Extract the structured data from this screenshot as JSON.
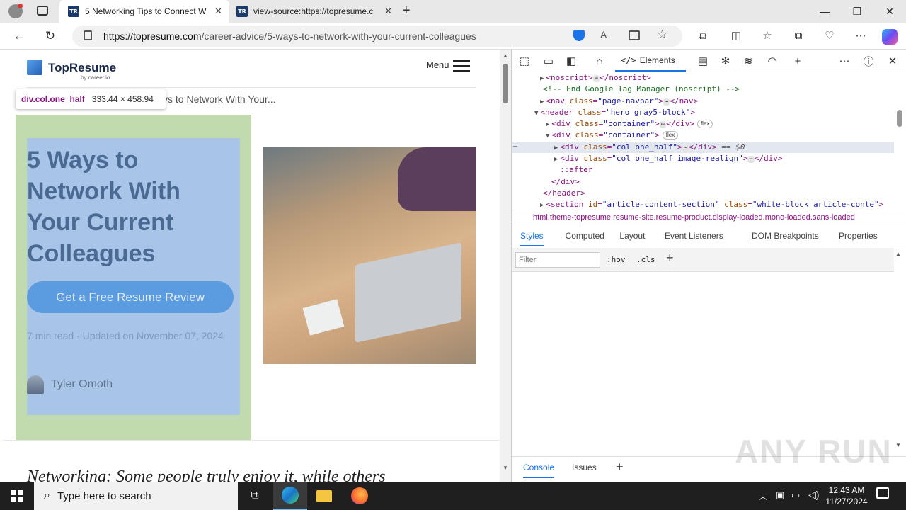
{
  "browser": {
    "tabs": [
      {
        "title": "5 Networking Tips to Connect W",
        "favicon": "TR"
      },
      {
        "title": "view-source:https://topresume.c",
        "favicon": "TR"
      }
    ],
    "url_host": "https://topresume.com",
    "url_path": "/career-advice/5-ways-to-network-with-your-current-colleagues"
  },
  "site": {
    "brand": "TopResume",
    "brand_sub": "by career.io",
    "menu_label": "Menu",
    "breadcrumb": "ys to Network With Your...",
    "inspect_tooltip": {
      "selector": "div.col.one_half",
      "dims": "333.44 × 458.94"
    },
    "heading": "5 Ways to Network With Your Current Colleagues",
    "cta": "Get a Free Resume Review",
    "meta": "7 min read · Updated on November 07, 2024",
    "author": "Tyler Omoth",
    "body_start": "Networking: Some people truly enjoy it, while others"
  },
  "devtools": {
    "elements_tab": "Elements",
    "lines": [
      {
        "indent": 40,
        "arrow": "▶",
        "html": "<noscript>",
        "dots": true,
        "close": "</noscript>"
      },
      {
        "indent": 44,
        "comment": "<!-- End Google Tag Manager (noscript) -->"
      },
      {
        "indent": 40,
        "arrow": "▶",
        "tag": "nav",
        "attrs": [
          [
            "class",
            "page-navbar"
          ]
        ],
        "dots": true,
        "close": "</nav>"
      },
      {
        "indent": 32,
        "arrow": "▼",
        "tag": "header",
        "attrs": [
          [
            "class",
            "hero gray5-block"
          ]
        ]
      },
      {
        "indent": 48,
        "arrow": "▶",
        "tag": "div",
        "attrs": [
          [
            "class",
            "container"
          ]
        ],
        "dots": true,
        "close": "</div>",
        "chip": "flex"
      },
      {
        "indent": 48,
        "arrow": "▼",
        "tag": "div",
        "attrs": [
          [
            "class",
            "container"
          ]
        ],
        "chip": "flex"
      },
      {
        "indent": 60,
        "arrow": "▶",
        "tag": "div",
        "attrs": [
          [
            "class",
            "col one_half"
          ]
        ],
        "dots": true,
        "close": "</div>",
        "selected": true,
        "eq": " == $0"
      },
      {
        "indent": 60,
        "arrow": "▶",
        "tag": "div",
        "attrs": [
          [
            "class",
            "col one_half image-realign"
          ]
        ],
        "dots": true,
        "close": "</div>"
      },
      {
        "indent": 68,
        "pseudo": "::after"
      },
      {
        "indent": 56,
        "close_only": "</div>"
      },
      {
        "indent": 44,
        "close_only": "</header>"
      },
      {
        "indent": 40,
        "arrow": "▶",
        "tag": "section",
        "attrs": [
          [
            "id",
            "article-content-section"
          ],
          [
            "class",
            "white-block article-conte"
          ]
        ]
      }
    ],
    "crumb": "html.theme-topresume.resume-site.resume-product.display-loaded.mono-loaded.sans-loaded",
    "styles_tabs": [
      "Styles",
      "Computed",
      "Layout",
      "Event Listeners",
      "DOM Breakpoints",
      "Properties"
    ],
    "filter_placeholder": "Filter",
    "hov": ":hov",
    "cls": ".cls",
    "drawer_tabs": [
      "Console",
      "Issues"
    ]
  },
  "taskbar": {
    "search_placeholder": "Type here to search",
    "time": "12:43 AM",
    "date": "11/27/2024"
  },
  "watermark": "ANY RUN"
}
